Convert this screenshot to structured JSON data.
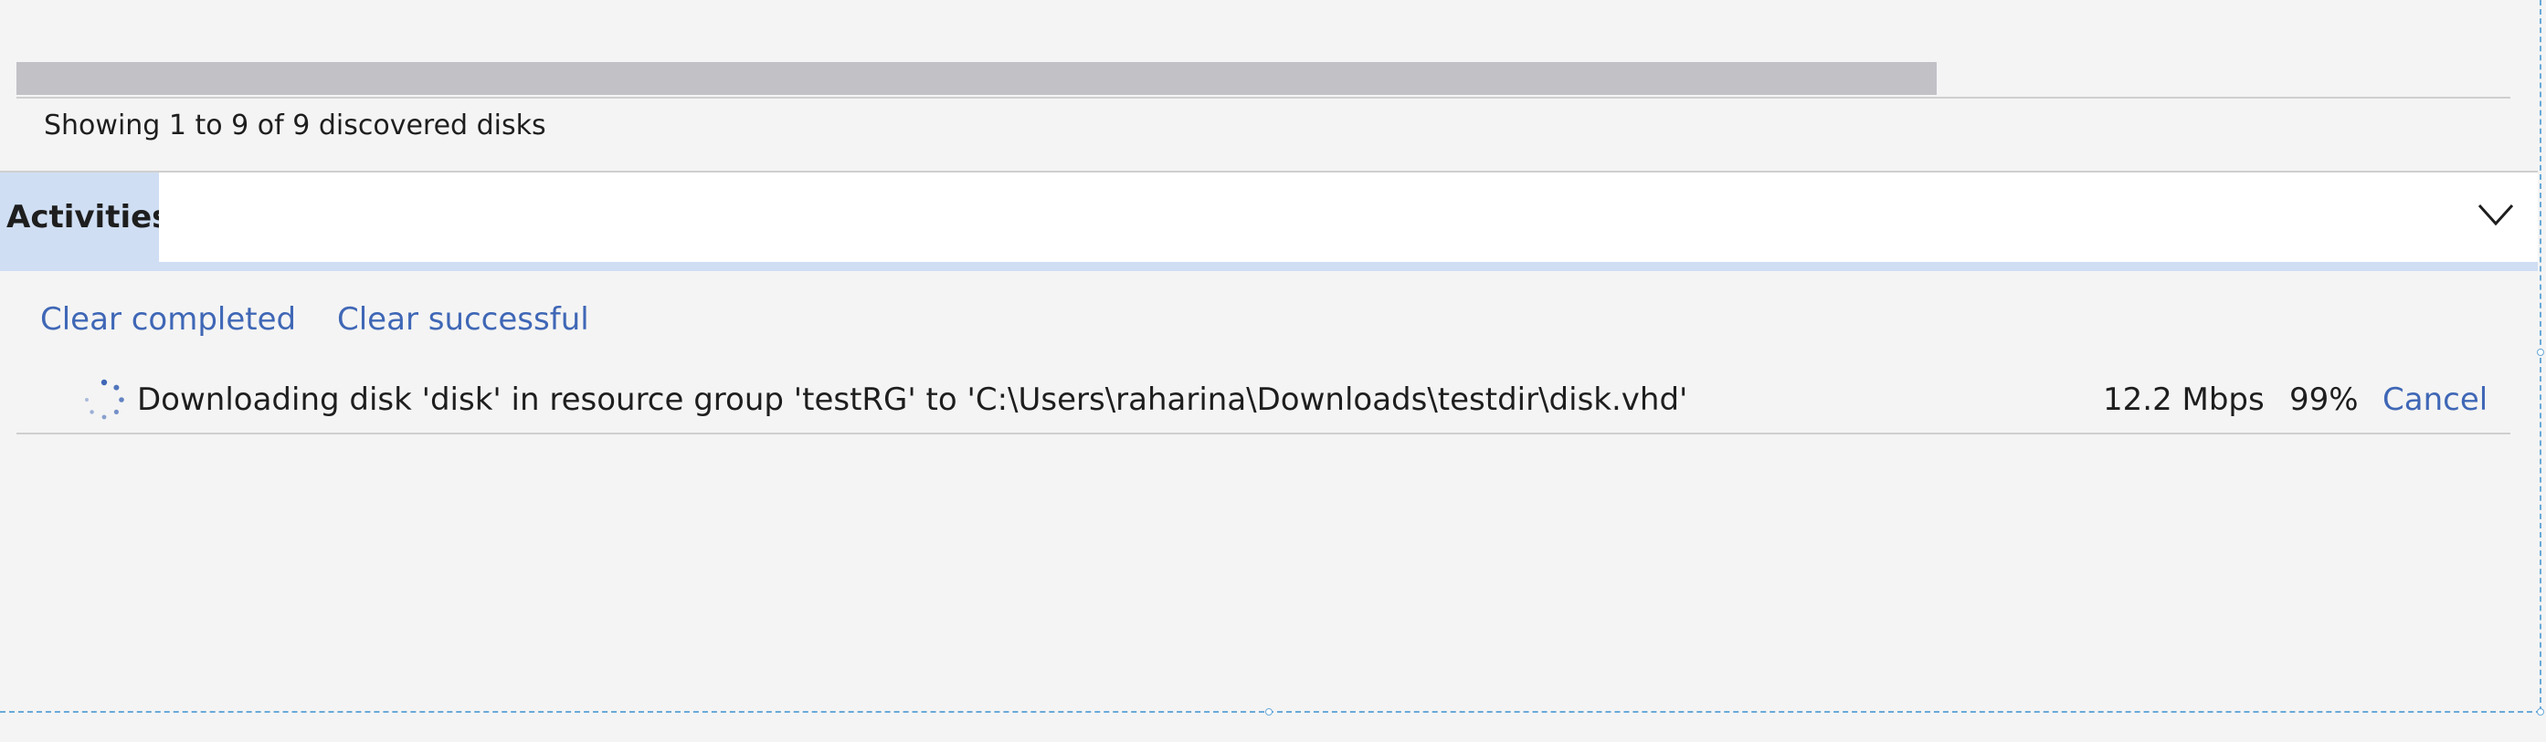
{
  "discovered": {
    "status_text": "Showing 1 to 9 of 9 discovered disks"
  },
  "activities": {
    "tab_label": "Activities",
    "clear_completed": "Clear completed",
    "clear_successful": "Clear successful",
    "items": [
      {
        "description": "Downloading disk 'disk' in resource group 'testRG' to 'C:\\Users\\raharina\\Downloads\\testdir\\disk.vhd'",
        "speed": "12.2 Mbps",
        "progress": "99%",
        "cancel_label": "Cancel",
        "status_icon": "spinner-icon"
      }
    ]
  },
  "icons": {
    "expand": "chevron-down-icon"
  },
  "colors": {
    "link": "#3f67b6",
    "header_band": "#cfdef3",
    "background": "#f4f4f4",
    "scroll_thumb": "#c1c1c6",
    "selection_outline": "#6aa9d8"
  }
}
